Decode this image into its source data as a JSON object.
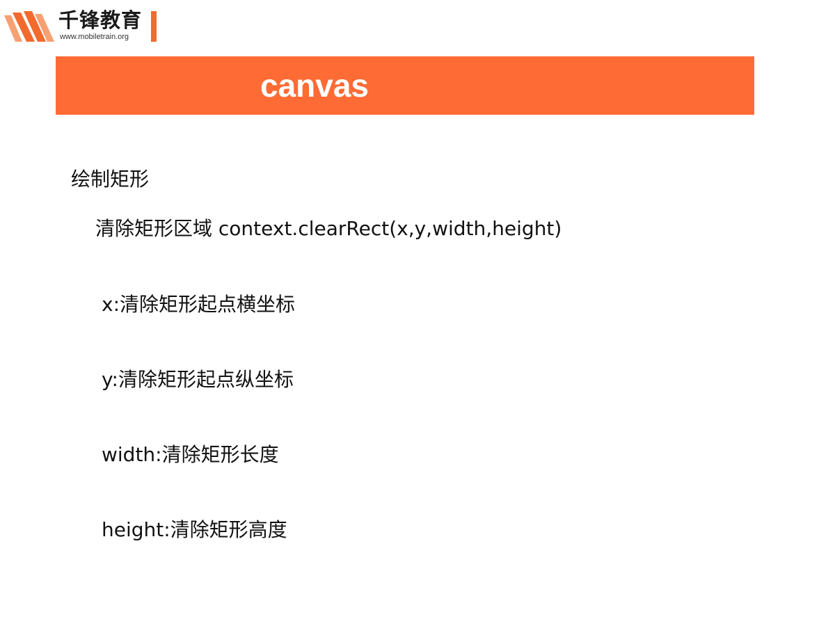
{
  "logo": {
    "name_cn": "千锋教育",
    "url": "www.mobiletrain.org",
    "colors": {
      "stripe_orange": "#f26a2e",
      "stripe_light": "#f7a072"
    }
  },
  "slide": {
    "title": "canvas",
    "banner_color": "#ff6b35",
    "heading": "绘制矩形",
    "api_line": "清除矩形区域 context.clearRect(x,y,width,height)",
    "params": [
      "x:清除矩形起点横坐标",
      "y:清除矩形起点纵坐标",
      "width:清除矩形长度",
      "height:清除矩形高度"
    ]
  }
}
